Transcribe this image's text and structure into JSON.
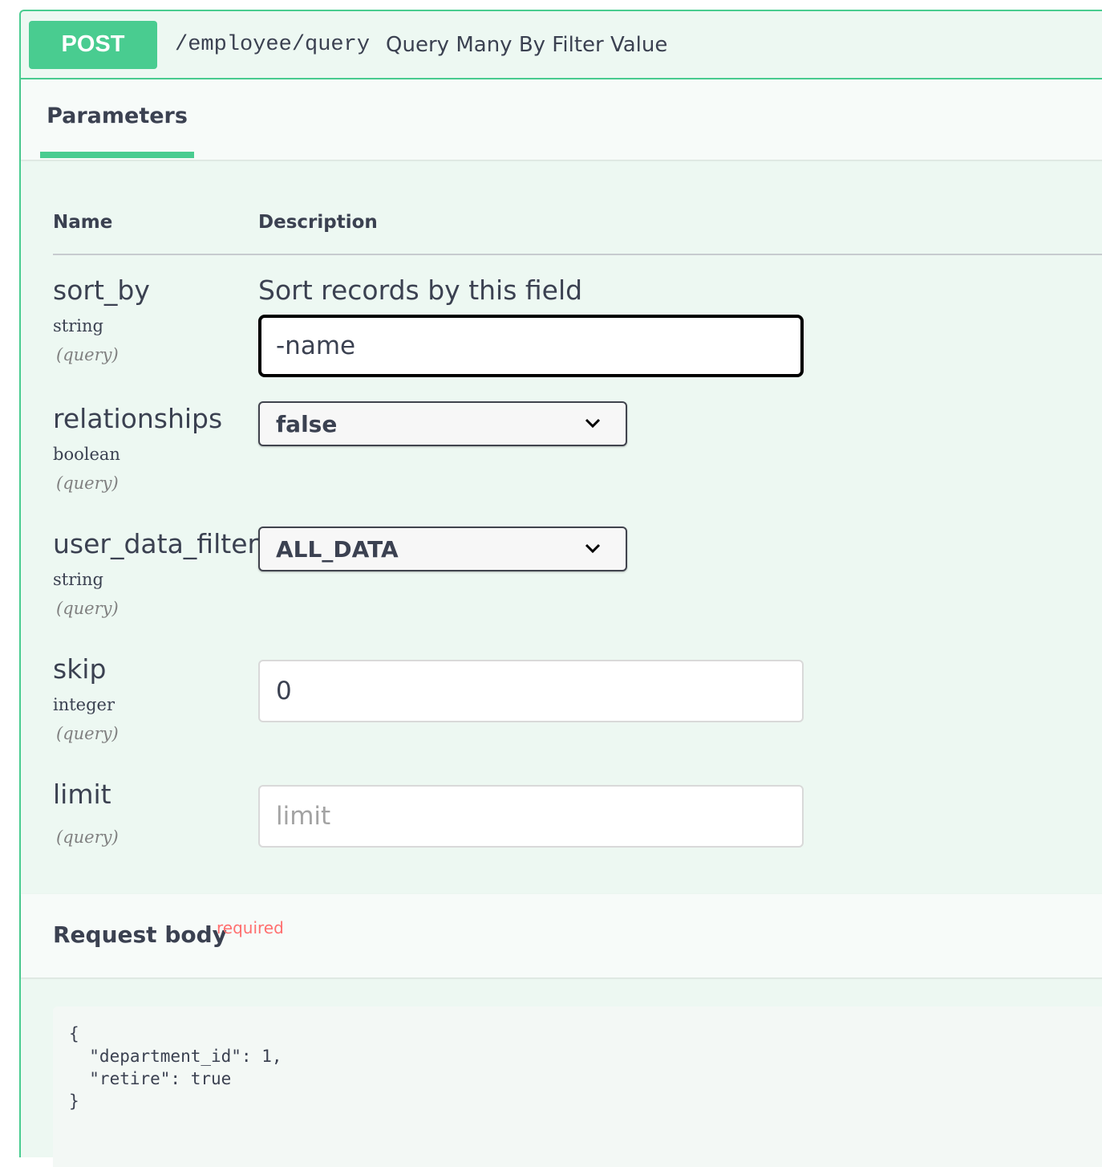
{
  "operation": {
    "method": "POST",
    "path": "/employee/query",
    "summary": "Query Many By Filter Value"
  },
  "tabs": {
    "parameters": "Parameters"
  },
  "table": {
    "name_header": "Name",
    "description_header": "Description"
  },
  "params": [
    {
      "name": "sort_by",
      "type": "string",
      "in": "(query)",
      "description": "Sort records by this field",
      "value": "-name"
    },
    {
      "name": "relationships",
      "type": "boolean",
      "in": "(query)",
      "selected": "false"
    },
    {
      "name": "user_data_filter",
      "type": "string",
      "in": "(query)",
      "selected": "ALL_DATA"
    },
    {
      "name": "skip",
      "type": "integer",
      "in": "(query)",
      "value": "0"
    },
    {
      "name": "limit",
      "in": "(query)",
      "placeholder": "limit"
    }
  ],
  "request_body": {
    "title": "Request body",
    "required_label": "required",
    "example": "{\n  \"department_id\": 1,\n  \"retire\": true\n}"
  },
  "colors": {
    "post_accent": "#49cc90",
    "background": "#edf8f2",
    "required": "#ff6f6f"
  }
}
